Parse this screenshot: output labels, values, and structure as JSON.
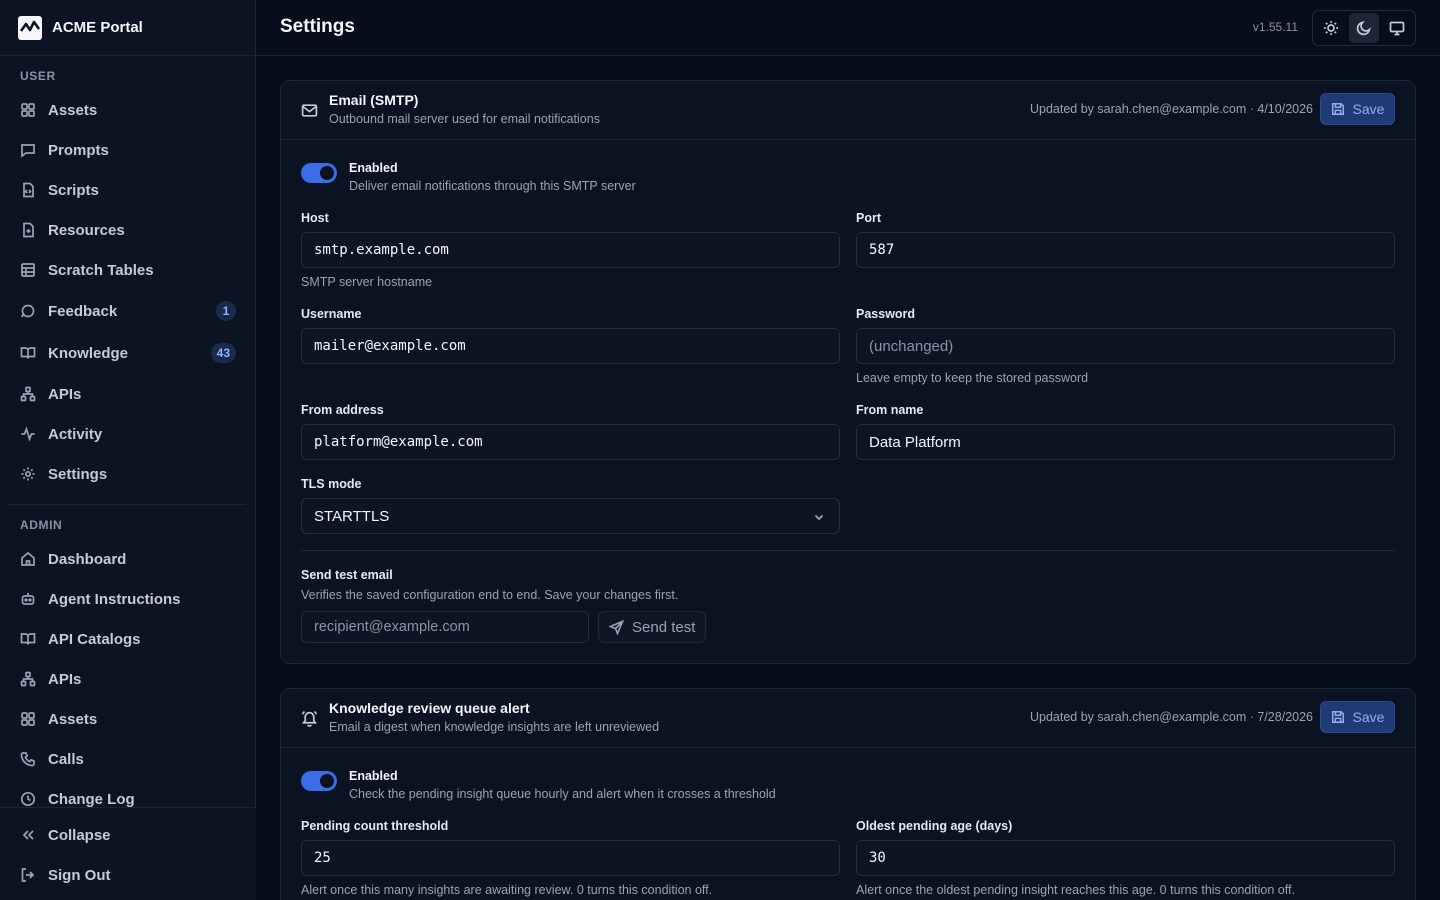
{
  "brand": {
    "name": "ACME Portal"
  },
  "sidebar": {
    "user_label": "USER",
    "admin_label": "ADMIN",
    "user_items": [
      {
        "label": "Assets",
        "icon": "grid-icon"
      },
      {
        "label": "Prompts",
        "icon": "message-square-icon"
      },
      {
        "label": "Scripts",
        "icon": "file-code-icon"
      },
      {
        "label": "Resources",
        "icon": "file-plus-icon"
      },
      {
        "label": "Scratch Tables",
        "icon": "table-icon"
      },
      {
        "label": "Feedback",
        "icon": "message-circle-icon",
        "badge": "1"
      },
      {
        "label": "Knowledge",
        "icon": "book-open-icon",
        "badge": "43"
      },
      {
        "label": "APIs",
        "icon": "network-icon"
      },
      {
        "label": "Activity",
        "icon": "activity-icon"
      },
      {
        "label": "Settings",
        "icon": "gear-icon"
      }
    ],
    "admin_items": [
      {
        "label": "Dashboard",
        "icon": "home-icon"
      },
      {
        "label": "Agent Instructions",
        "icon": "bot-icon"
      },
      {
        "label": "API Catalogs",
        "icon": "book-open-icon"
      },
      {
        "label": "APIs",
        "icon": "network-icon"
      },
      {
        "label": "Assets",
        "icon": "grid-icon"
      },
      {
        "label": "Calls",
        "icon": "phone-icon"
      },
      {
        "label": "Change Log",
        "icon": "clock-icon"
      }
    ],
    "collapse_label": "Collapse",
    "signout_label": "Sign Out"
  },
  "header": {
    "title": "Settings",
    "version": "v1.55.11"
  },
  "smtp": {
    "title": "Email (SMTP)",
    "subtitle": "Outbound mail server used for email notifications",
    "updated": "Updated by sarah.chen@example.com · 4/10/2026",
    "save_label": "Save",
    "enabled_label": "Enabled",
    "enabled_desc": "Deliver email notifications through this SMTP server",
    "host_label": "Host",
    "host_value": "smtp.example.com",
    "host_help": "SMTP server hostname",
    "port_label": "Port",
    "port_value": "587",
    "username_label": "Username",
    "username_value": "mailer@example.com",
    "password_label": "Password",
    "password_placeholder": "(unchanged)",
    "password_help": "Leave empty to keep the stored password",
    "from_address_label": "From address",
    "from_address_value": "platform@example.com",
    "from_name_label": "From name",
    "from_name_value": "Data Platform",
    "tls_label": "TLS mode",
    "tls_value": "STARTTLS",
    "test_title": "Send test email",
    "test_desc": "Verifies the saved configuration end to end. Save your changes first.",
    "test_placeholder": "recipient@example.com",
    "test_button": "Send test"
  },
  "review": {
    "title": "Knowledge review queue alert",
    "subtitle": "Email a digest when knowledge insights are left unreviewed",
    "updated": "Updated by sarah.chen@example.com · 7/28/2026",
    "save_label": "Save",
    "enabled_label": "Enabled",
    "enabled_desc": "Check the pending insight queue hourly and alert when it crosses a threshold",
    "count_label": "Pending count threshold",
    "count_value": "25",
    "count_help": "Alert once this many insights are awaiting review. 0 turns this condition off.",
    "age_label": "Oldest pending age (days)",
    "age_value": "30",
    "age_help": "Alert once the oldest pending insight reaches this age. 0 turns this condition off."
  },
  "colors": {
    "accent": "#3b6ee6",
    "background": "#060c18",
    "sidebar": "#0c1322"
  }
}
